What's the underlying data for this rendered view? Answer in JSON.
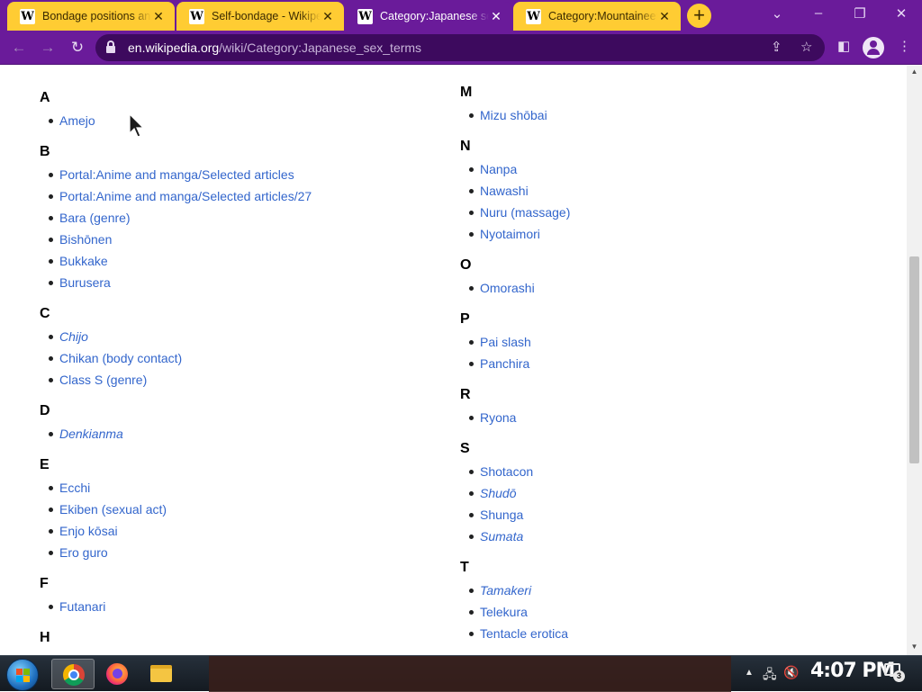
{
  "browser": {
    "tabs": [
      {
        "title": "Bondage positions and",
        "favicon": "W",
        "active": false
      },
      {
        "title": "Self-bondage - Wikipedia",
        "favicon": "W",
        "active": false
      },
      {
        "title": "Category:Japanese sex",
        "favicon": "W",
        "active": true
      },
      {
        "title": "Category:Mountaineer",
        "favicon": "W",
        "active": false
      }
    ],
    "new_tab_label": "+",
    "address": {
      "host": "en.wikipedia.org",
      "path": "/wiki/Category:Japanese_sex_terms"
    },
    "theme_color": "#6a1b9a",
    "inactive_tab_color": "#ffcc33"
  },
  "content": {
    "link_color": "#3366cc",
    "left_column": [
      {
        "letter": "A",
        "items": [
          {
            "text": "Amejo",
            "italic": false
          }
        ]
      },
      {
        "letter": "B",
        "items": [
          {
            "text": "Portal:Anime and manga/Selected articles",
            "italic": false
          },
          {
            "text": "Portal:Anime and manga/Selected articles/27",
            "italic": false
          },
          {
            "text": "Bara (genre)",
            "italic": false
          },
          {
            "text": "Bishōnen",
            "italic": false
          },
          {
            "text": "Bukkake",
            "italic": false
          },
          {
            "text": "Burusera",
            "italic": false
          }
        ]
      },
      {
        "letter": "C",
        "items": [
          {
            "text": "Chijo",
            "italic": true
          },
          {
            "text": "Chikan (body contact)",
            "italic": false
          },
          {
            "text": "Class S (genre)",
            "italic": false
          }
        ]
      },
      {
        "letter": "D",
        "items": [
          {
            "text": "Denkianma",
            "italic": true
          }
        ]
      },
      {
        "letter": "E",
        "items": [
          {
            "text": "Ecchi",
            "italic": false
          },
          {
            "text": "Ekiben (sexual act)",
            "italic": false
          },
          {
            "text": "Enjo kōsai",
            "italic": false
          },
          {
            "text": "Ero guro",
            "italic": false
          }
        ]
      },
      {
        "letter": "F",
        "items": [
          {
            "text": "Futanari",
            "italic": false
          }
        ]
      },
      {
        "letter": "H",
        "items": []
      }
    ],
    "right_column": [
      {
        "letter": "M",
        "items": [
          {
            "text": "Mizu shōbai",
            "italic": false
          }
        ]
      },
      {
        "letter": "N",
        "items": [
          {
            "text": "Nanpa",
            "italic": false
          },
          {
            "text": "Nawashi",
            "italic": false
          },
          {
            "text": "Nuru (massage)",
            "italic": false
          },
          {
            "text": "Nyotaimori",
            "italic": false
          }
        ]
      },
      {
        "letter": "O",
        "items": [
          {
            "text": "Omorashi",
            "italic": false
          }
        ]
      },
      {
        "letter": "P",
        "items": [
          {
            "text": "Pai slash",
            "italic": false
          },
          {
            "text": "Panchira",
            "italic": false
          }
        ]
      },
      {
        "letter": "R",
        "items": [
          {
            "text": "Ryona",
            "italic": false
          }
        ]
      },
      {
        "letter": "S",
        "items": [
          {
            "text": "Shotacon",
            "italic": false
          },
          {
            "text": "Shudō",
            "italic": true
          },
          {
            "text": "Shunga",
            "italic": false
          },
          {
            "text": "Sumata",
            "italic": true
          }
        ]
      },
      {
        "letter": "T",
        "items": [
          {
            "text": "Tamakeri",
            "italic": true
          },
          {
            "text": "Telekura",
            "italic": false
          },
          {
            "text": "Tentacle erotica",
            "italic": false
          }
        ]
      }
    ]
  },
  "taskbar": {
    "apps": [
      "chrome-icon",
      "firefox-icon",
      "file-explorer-icon"
    ],
    "clock": "4:07 PM",
    "notification_count": "3"
  }
}
